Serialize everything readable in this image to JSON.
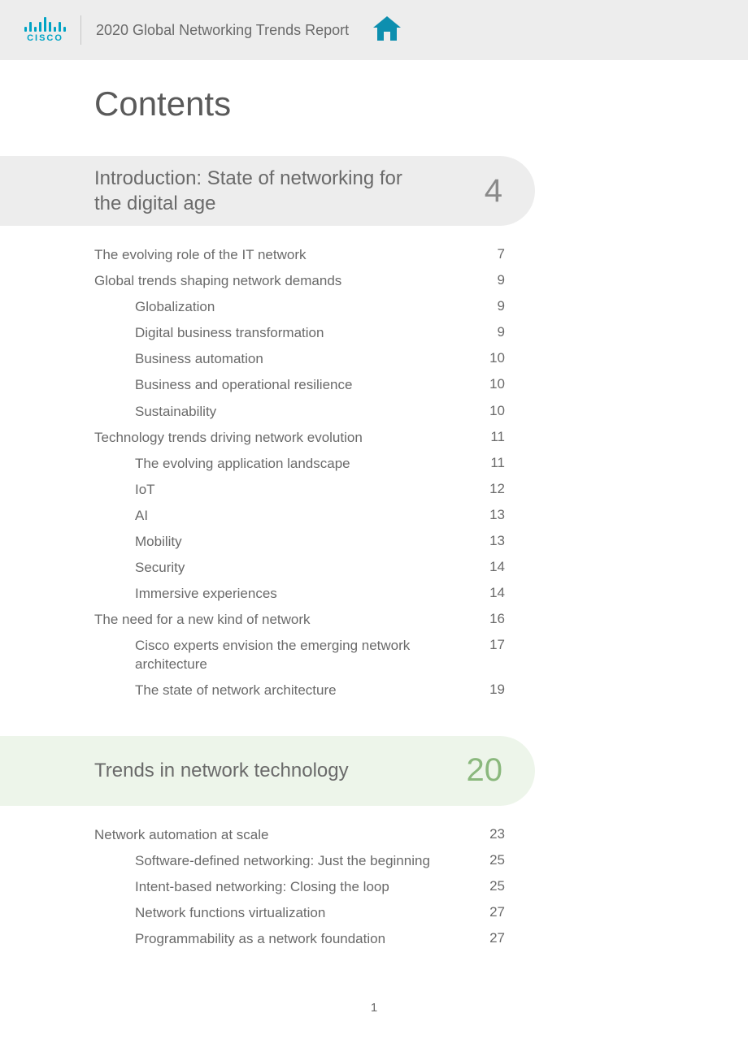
{
  "header": {
    "logo_text": "CISCO",
    "title": "2020 Global Networking Trends Report"
  },
  "contents_heading": "Contents",
  "sections": [
    {
      "title": "Introduction: State of networking for the digital age",
      "page": "4",
      "style": "gray",
      "items": [
        {
          "level": 1,
          "title": "The evolving role of the IT network",
          "page": "7"
        },
        {
          "level": 1,
          "title": "Global trends shaping network demands",
          "page": "9"
        },
        {
          "level": 2,
          "title": "Globalization",
          "page": "9"
        },
        {
          "level": 2,
          "title": "Digital business transformation",
          "page": "9"
        },
        {
          "level": 2,
          "title": "Business automation",
          "page": "10"
        },
        {
          "level": 2,
          "title": "Business and operational resilience",
          "page": "10"
        },
        {
          "level": 2,
          "title": "Sustainability",
          "page": "10"
        },
        {
          "level": 1,
          "title": "Technology trends driving network evolution",
          "page": "11"
        },
        {
          "level": 2,
          "title": "The evolving application landscape",
          "page": "11"
        },
        {
          "level": 2,
          "title": "IoT",
          "page": "12"
        },
        {
          "level": 2,
          "title": "AI",
          "page": "13"
        },
        {
          "level": 2,
          "title": "Mobility",
          "page": "13"
        },
        {
          "level": 2,
          "title": "Security",
          "page": "14"
        },
        {
          "level": 2,
          "title": "Immersive experiences",
          "page": "14"
        },
        {
          "level": 1,
          "title": "The need for a new kind of network",
          "page": "16"
        },
        {
          "level": 2,
          "title": "Cisco experts envision the emerging network architecture",
          "page": "17"
        },
        {
          "level": 2,
          "title": "The state of network architecture",
          "page": "19"
        }
      ]
    },
    {
      "title": "Trends in network technology",
      "page": "20",
      "style": "green",
      "items": [
        {
          "level": 1,
          "title": "Network automation at scale",
          "page": "23"
        },
        {
          "level": 2,
          "title": "Software-defined networking: Just the beginning",
          "page": "25"
        },
        {
          "level": 2,
          "title": "Intent-based networking: Closing the loop",
          "page": "25"
        },
        {
          "level": 2,
          "title": "Network functions virtualization",
          "page": "27"
        },
        {
          "level": 2,
          "title": "Programmability as a network foundation",
          "page": "27"
        }
      ]
    }
  ],
  "page_number": "1"
}
